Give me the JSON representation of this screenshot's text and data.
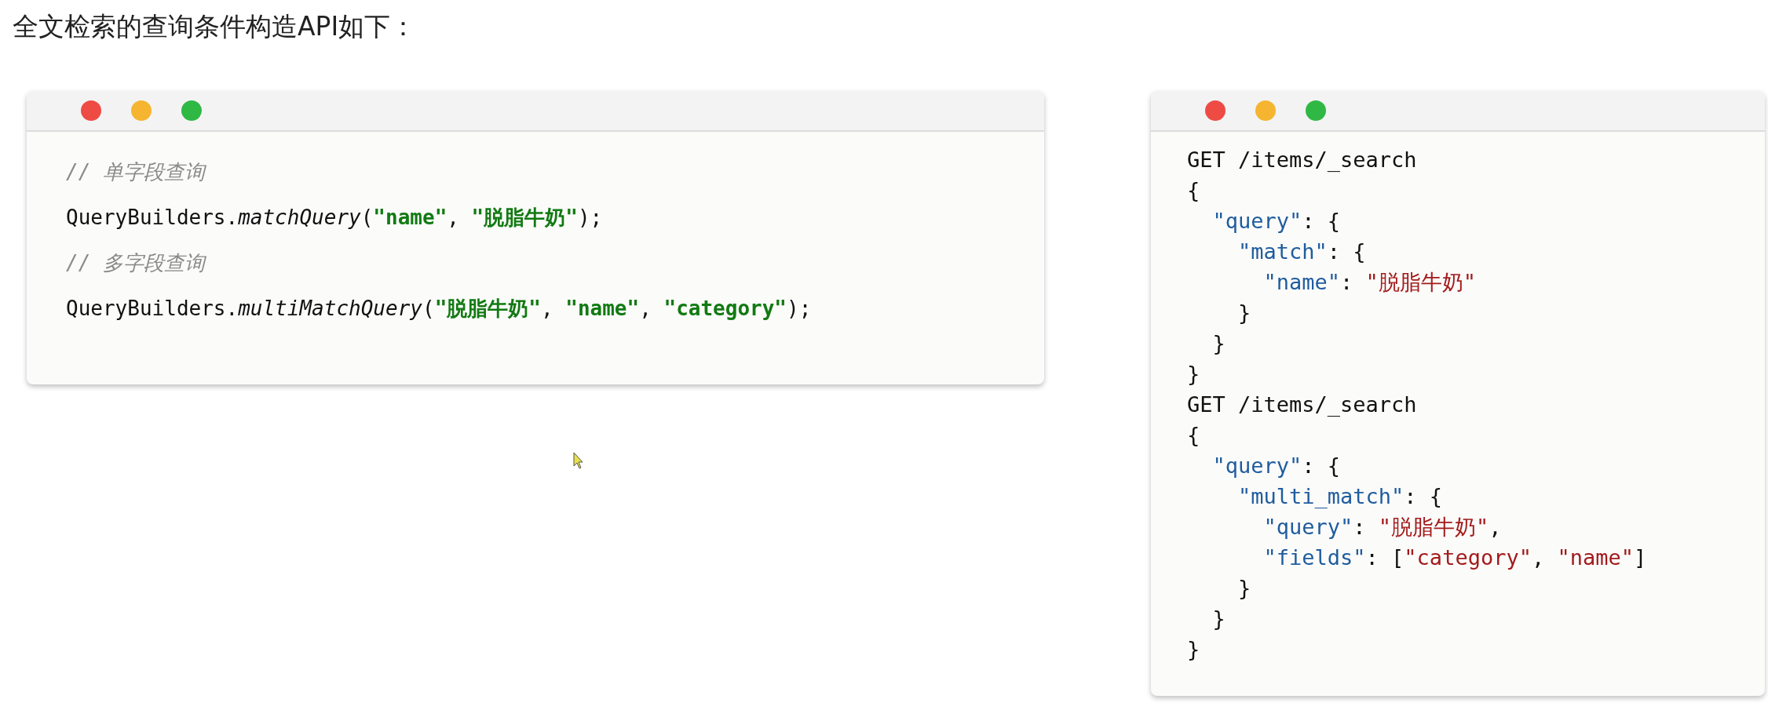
{
  "heading": "全文检索的查询条件构造API如下：",
  "windows": [
    {
      "lines": [
        [
          {
            "kind": "comment",
            "text": "// 单字段查询"
          }
        ],
        [
          {
            "kind": "plain",
            "text": "QueryBuilders."
          },
          {
            "kind": "method",
            "text": "matchQuery"
          },
          {
            "kind": "plain",
            "text": "("
          },
          {
            "kind": "bold",
            "text": "\"name\""
          },
          {
            "kind": "plain",
            "text": ", "
          },
          {
            "kind": "bold",
            "text": "\"脱脂牛奶\""
          },
          {
            "kind": "plain",
            "text": ");"
          }
        ],
        [
          {
            "kind": "comment",
            "text": "// 多字段查询"
          }
        ],
        [
          {
            "kind": "plain",
            "text": "QueryBuilders."
          },
          {
            "kind": "method",
            "text": "multiMatchQuery"
          },
          {
            "kind": "plain",
            "text": "("
          },
          {
            "kind": "bold",
            "text": "\"脱脂牛奶\""
          },
          {
            "kind": "plain",
            "text": ", "
          },
          {
            "kind": "bold",
            "text": "\"name\""
          },
          {
            "kind": "plain",
            "text": ", "
          },
          {
            "kind": "bold",
            "text": "\"category\""
          },
          {
            "kind": "plain",
            "text": ");"
          }
        ]
      ]
    },
    {
      "lines": [
        [
          {
            "kind": "plain",
            "text": "GET /items/_search"
          }
        ],
        [
          {
            "kind": "plain",
            "text": "{"
          }
        ],
        [
          {
            "kind": "key",
            "text": "  \"query\""
          },
          {
            "kind": "plain",
            "text": ": {"
          }
        ],
        [
          {
            "kind": "key",
            "text": "    \"match\""
          },
          {
            "kind": "plain",
            "text": ": {"
          }
        ],
        [
          {
            "kind": "key",
            "text": "      \"name\""
          },
          {
            "kind": "plain",
            "text": ": "
          },
          {
            "kind": "string",
            "text": "\"脱脂牛奶\""
          }
        ],
        [
          {
            "kind": "plain",
            "text": "    }"
          }
        ],
        [
          {
            "kind": "plain",
            "text": "  }"
          }
        ],
        [
          {
            "kind": "plain",
            "text": "}"
          }
        ],
        [
          {
            "kind": "plain",
            "text": "GET /items/_search"
          }
        ],
        [
          {
            "kind": "plain",
            "text": "{"
          }
        ],
        [
          {
            "kind": "key",
            "text": "  \"query\""
          },
          {
            "kind": "plain",
            "text": ": {"
          }
        ],
        [
          {
            "kind": "key",
            "text": "    \"multi_match\""
          },
          {
            "kind": "plain",
            "text": ": {"
          }
        ],
        [
          {
            "kind": "key",
            "text": "      \"query\""
          },
          {
            "kind": "plain",
            "text": ": "
          },
          {
            "kind": "string",
            "text": "\"脱脂牛奶\""
          },
          {
            "kind": "plain",
            "text": ","
          }
        ],
        [
          {
            "kind": "key",
            "text": "      \"fields\""
          },
          {
            "kind": "plain",
            "text": ": ["
          },
          {
            "kind": "string",
            "text": "\"category\""
          },
          {
            "kind": "plain",
            "text": ", "
          },
          {
            "kind": "string",
            "text": "\"name\""
          },
          {
            "kind": "plain",
            "text": "]"
          }
        ],
        [
          {
            "kind": "plain",
            "text": "    }"
          }
        ],
        [
          {
            "kind": "plain",
            "text": "  }"
          }
        ],
        [
          {
            "kind": "plain",
            "text": "}"
          }
        ]
      ]
    }
  ]
}
